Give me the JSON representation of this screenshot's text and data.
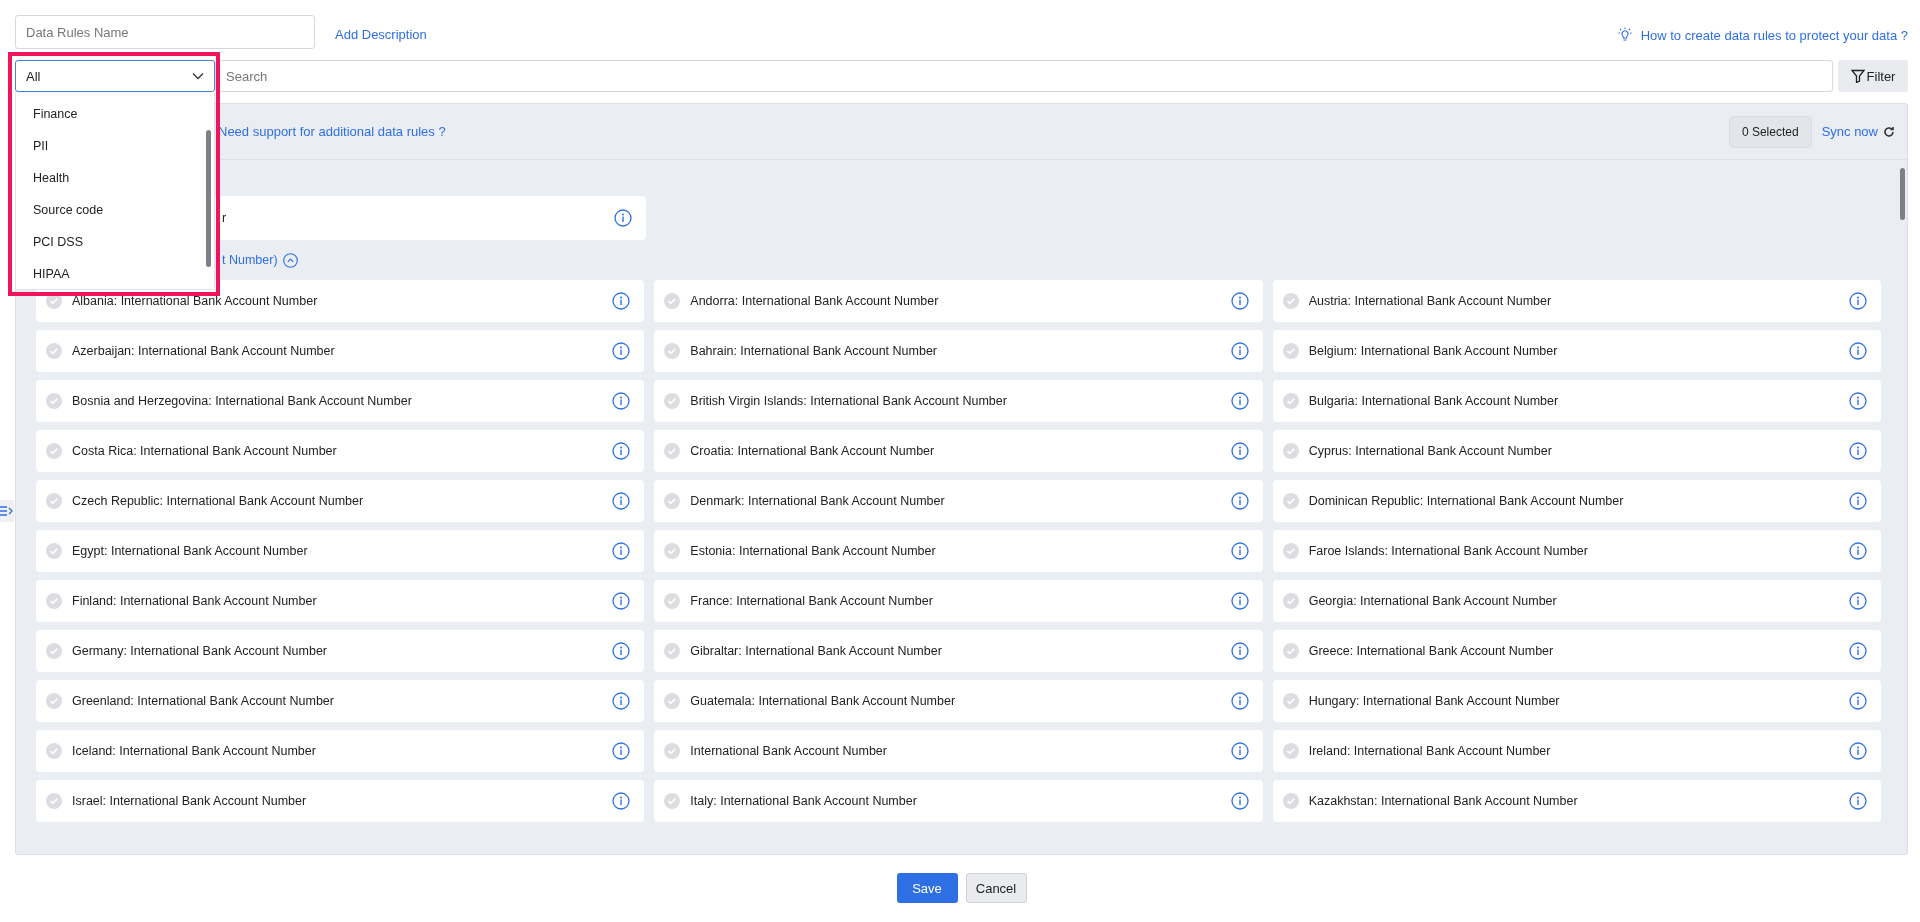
{
  "name_field": {
    "placeholder": "Data Rules Name"
  },
  "add_description": "Add Description",
  "help_link": "How to create data rules to protect your data ?",
  "category_select": {
    "value": "All",
    "expanded": true,
    "options": [
      "Finance",
      "PII",
      "Health",
      "Source code",
      "PCI DSS",
      "HIPAA"
    ]
  },
  "search": {
    "placeholder": "Search"
  },
  "filter_button": "Filter",
  "support_link": "Need support for additional data rules ?",
  "selected_count": "0 Selected",
  "sync_link": "Sync now",
  "partial_card": {
    "text": "r"
  },
  "section": {
    "label": "t Number)",
    "expanded": true
  },
  "rules": [
    {
      "name": "Albania: International Bank Account Number",
      "checked": false
    },
    {
      "name": "Andorra: International Bank Account Number",
      "checked": false
    },
    {
      "name": "Austria: International Bank Account Number",
      "checked": false
    },
    {
      "name": "Azerbaijan: International Bank Account Number",
      "checked": false
    },
    {
      "name": "Bahrain: International Bank Account Number",
      "checked": false
    },
    {
      "name": "Belgium: International Bank Account Number",
      "checked": false
    },
    {
      "name": "Bosnia and Herzegovina: International Bank Account Number",
      "checked": false
    },
    {
      "name": "British Virgin Islands: International Bank Account Number",
      "checked": false
    },
    {
      "name": "Bulgaria: International Bank Account Number",
      "checked": false
    },
    {
      "name": "Costa Rica: International Bank Account Number",
      "checked": false
    },
    {
      "name": "Croatia: International Bank Account Number",
      "checked": false
    },
    {
      "name": "Cyprus: International Bank Account Number",
      "checked": false
    },
    {
      "name": "Czech Republic: International Bank Account Number",
      "checked": false
    },
    {
      "name": "Denmark: International Bank Account Number",
      "checked": false
    },
    {
      "name": "Dominican Republic: International Bank Account Number",
      "checked": false
    },
    {
      "name": "Egypt: International Bank Account Number",
      "checked": false
    },
    {
      "name": "Estonia: International Bank Account Number",
      "checked": false
    },
    {
      "name": "Faroe Islands: International Bank Account Number",
      "checked": false
    },
    {
      "name": "Finland: International Bank Account Number",
      "checked": false
    },
    {
      "name": "France: International Bank Account Number",
      "checked": false
    },
    {
      "name": "Georgia: International Bank Account Number",
      "checked": false
    },
    {
      "name": "Germany: International Bank Account Number",
      "checked": false
    },
    {
      "name": "Gibraltar: International Bank Account Number",
      "checked": false
    },
    {
      "name": "Greece: International Bank Account Number",
      "checked": false
    },
    {
      "name": "Greenland: International Bank Account Number",
      "checked": false
    },
    {
      "name": "Guatemala: International Bank Account Number",
      "checked": false
    },
    {
      "name": "Hungary: International Bank Account Number",
      "checked": false
    },
    {
      "name": "Iceland: International Bank Account Number",
      "checked": false
    },
    {
      "name": "International Bank Account Number",
      "checked": false
    },
    {
      "name": "Ireland: International Bank Account Number",
      "checked": false
    },
    {
      "name": "Israel: International Bank Account Number",
      "checked": false
    },
    {
      "name": "Italy: International Bank Account Number",
      "checked": false
    },
    {
      "name": "Kazakhstan: International Bank Account Number",
      "checked": false
    }
  ],
  "buttons": {
    "save": "Save",
    "cancel": "Cancel"
  }
}
